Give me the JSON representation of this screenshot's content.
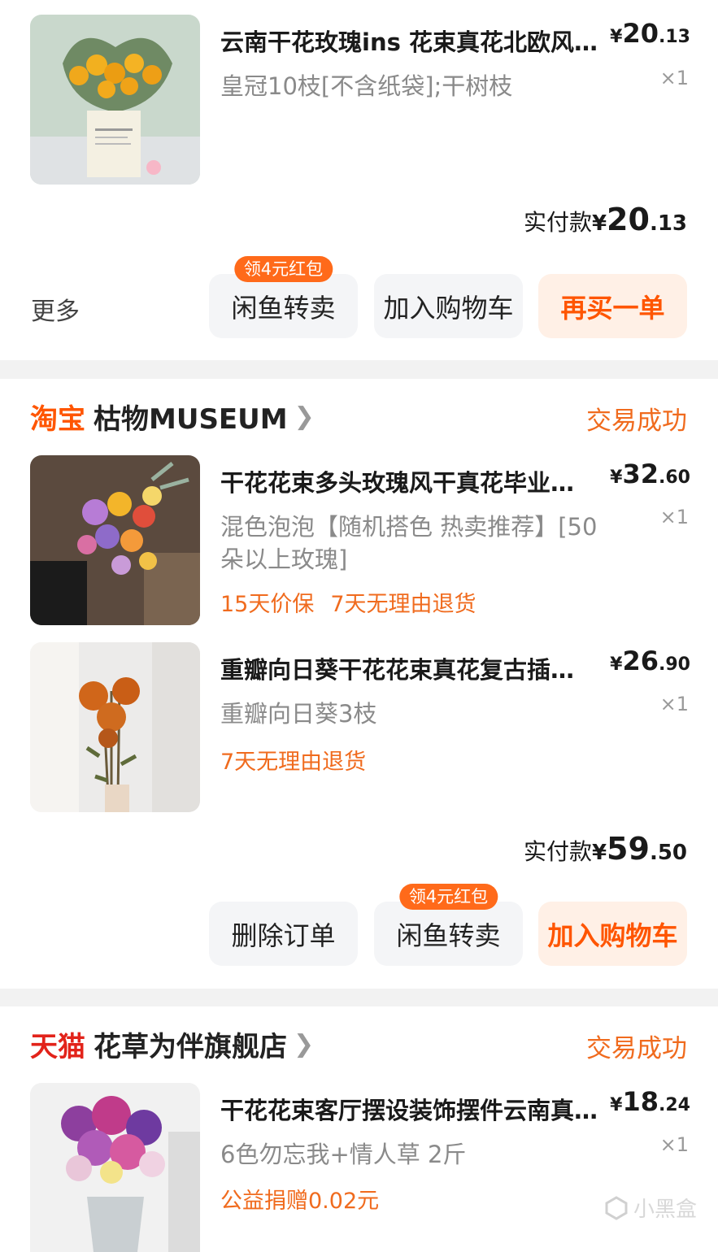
{
  "colors": {
    "accent": "#ff5500",
    "service": "#f06b1e",
    "badge": "#ff6a1a"
  },
  "order1": {
    "item": {
      "title": "云南干花玫瑰ins 花束真花北欧风…",
      "sku": "皇冠10枝[不含纸袋];干树枝",
      "price_cur": "¥",
      "price_int": "20",
      "price_dec": ".13",
      "qty": "×1"
    },
    "paid_label": "实付款",
    "paid_cur": "¥",
    "paid_int": "20",
    "paid_dec": ".13",
    "more": "更多",
    "buttons": {
      "resell": "闲鱼转卖",
      "resell_badge": "领4元红包",
      "cart": "加入购物车",
      "rebuy": "再买一单"
    }
  },
  "order2": {
    "platform": "淘宝",
    "shop": "枯物MUSEUM",
    "status": "交易成功",
    "items": [
      {
        "title": "干花花束多头玫瑰风干真花毕业…",
        "sku": "混色泡泡【随机搭色 热卖推荐】[50朵以上玫瑰]",
        "services": [
          "15天价保",
          "7天无理由退货"
        ],
        "price_cur": "¥",
        "price_int": "32",
        "price_dec": ".60",
        "qty": "×1"
      },
      {
        "title": "重瓣向日葵干花花束真花复古插…",
        "sku": "重瓣向日葵3枝",
        "services": [
          "7天无理由退货"
        ],
        "price_cur": "¥",
        "price_int": "26",
        "price_dec": ".90",
        "qty": "×1"
      }
    ],
    "paid_label": "实付款",
    "paid_cur": "¥",
    "paid_int": "59",
    "paid_dec": ".50",
    "buttons": {
      "delete": "删除订单",
      "resell": "闲鱼转卖",
      "resell_badge": "领4元红包",
      "cart": "加入购物车"
    }
  },
  "order3": {
    "platform": "天猫",
    "shop": "花草为伴旗舰店",
    "status": "交易成功",
    "item": {
      "title": "干花花束客厅摆设装饰摆件云南真…",
      "sku": "6色勿忘我+情人草 2斤",
      "services": [
        "公益捐赠0.02元"
      ],
      "price_cur": "¥",
      "price_int": "18",
      "price_dec": ".24",
      "qty": "×1"
    }
  },
  "watermark": "小黑盒"
}
